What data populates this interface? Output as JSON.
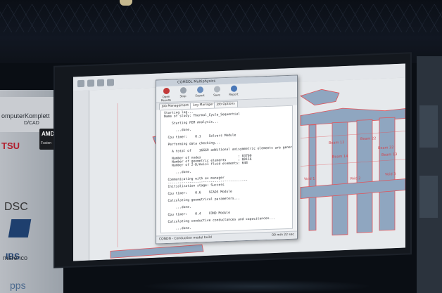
{
  "sponsors": {
    "line1": "omputerKomplett",
    "line2": "D/CAD",
    "line3": "TSU",
    "line4": "DSC",
    "line5": "IBS",
    "line6": "marenco",
    "line7": "pps",
    "amd_label": "AMD",
    "amd_sub": "Fusion"
  },
  "dialog": {
    "title": "COMSOL Multiphysics",
    "ribbon": [
      "Open Results",
      "Stop",
      "Export",
      "Save",
      "Report"
    ],
    "tabs": [
      "Job Management",
      "Log Manager",
      "Job Options"
    ],
    "log_lines": [
      "Starting log...",
      "Name of study: Thermal_Cycle_Sequential",
      "",
      "    Starting FEM Analysis...",
      "",
      "      ...done.",
      "",
      "  Cpu timer:    0.1    Solvers Module",
      "",
      "  Performing data checking...",
      "",
      "    A total of    16669 additional axisymmetric elements are generated",
      "",
      "    Number of nodes                   : 83700",
      "    Number of geometric elements      : 80156",
      "    Number of 2-D/Axis1 fluid elements: 648",
      "",
      "      ...done.",
      "",
      "  Communicating with ex manager",
      "  -----------------------------------------",
      "  Initialization stage: Success",
      "",
      "  Cpu timer:    0.6    SCADS Module",
      "",
      "  Calculating geometrical parameters...",
      "",
      "      ...done.",
      "",
      "  Cpu timer:    0.4    COND Module",
      "",
      "  Calculating conductive conductances and capacitances...",
      "",
      "      ...done."
    ],
    "status_left": "CONDN - Conduction model build",
    "status_right": "00 min 22 sec"
  },
  "canvas_labels": {
    "tags": [
      "Beam 12",
      "Beam 22",
      "Beam 14",
      "Beam 32",
      "Void 1",
      "Void 2",
      "Void 3",
      "Beam 13"
    ]
  },
  "colors": {
    "screen": "#cfd3d8",
    "canvas_fill": "#8fa6c0",
    "canvas_edge": "#e0545a"
  }
}
